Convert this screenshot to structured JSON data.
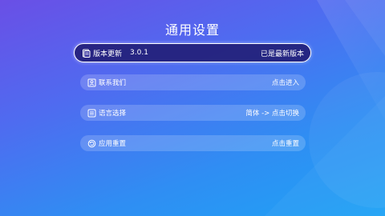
{
  "page": {
    "title": "通用设置"
  },
  "settings": {
    "items": [
      {
        "icon": "document-icon",
        "label": "版本更新",
        "version": "3.0.1",
        "action": "已是最新版本"
      },
      {
        "icon": "contact-icon",
        "label": "联系我们",
        "action": "点击进入"
      },
      {
        "icon": "language-icon",
        "label": "语言选择",
        "action": "简体 -> 点击切换"
      },
      {
        "icon": "reset-icon",
        "label": "应用重置",
        "action": "点击重置"
      }
    ]
  },
  "colors": {
    "background_top": "#6a4fe6",
    "background_bottom": "#1fa3f5",
    "focused_row": "#232078",
    "text": "#ffffff"
  }
}
